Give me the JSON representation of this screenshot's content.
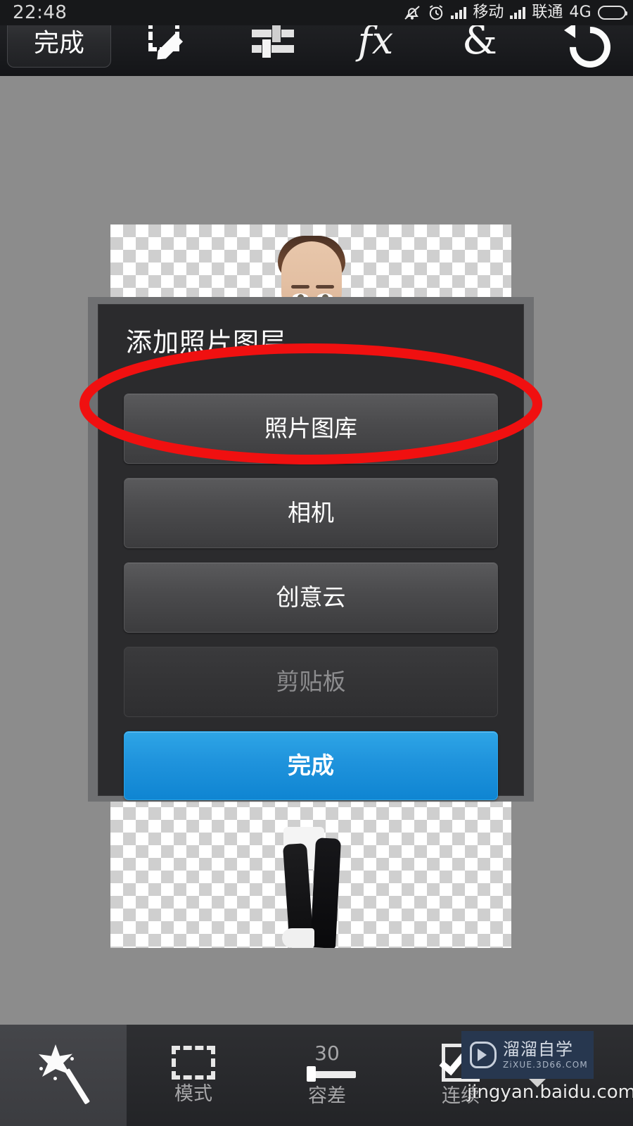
{
  "status_bar": {
    "clock": "22:48",
    "icons": [
      "bell-muted-icon",
      "alarm-clock-icon"
    ],
    "carrier_1": "移动",
    "carrier_2": "联通",
    "network_type": "4G",
    "battery_icon": "battery-icon"
  },
  "top_toolbar": {
    "done_label": "完成",
    "items": [
      {
        "name": "selection-edit-icon",
        "glyph": ""
      },
      {
        "name": "adjustments-sliders-icon",
        "glyph": ""
      },
      {
        "name": "effects-fx-icon",
        "glyph": "fx"
      },
      {
        "name": "blend-ampersand-icon",
        "glyph": "&"
      },
      {
        "name": "undo-icon",
        "glyph": ""
      }
    ]
  },
  "canvas": {
    "layer_kind": "transparent-checkerboard",
    "photo_description": "woman-cutout-photo-layer"
  },
  "dialog": {
    "title": "添加照片图层",
    "buttons": [
      {
        "id": "photo-library",
        "label": "照片图库",
        "style": "normal",
        "highlighted": true
      },
      {
        "id": "camera",
        "label": "相机",
        "style": "normal",
        "highlighted": false
      },
      {
        "id": "creative-cloud",
        "label": "创意云",
        "style": "normal",
        "highlighted": false
      },
      {
        "id": "clipboard",
        "label": "剪贴板",
        "style": "disabled",
        "highlighted": false
      },
      {
        "id": "done",
        "label": "完成",
        "style": "primary",
        "highlighted": false
      }
    ]
  },
  "annotation": {
    "shape": "ellipse",
    "color": "#f01010",
    "target": "照片图库"
  },
  "bottom_toolbar": {
    "tool_icon": "magic-wand-icon",
    "cells": [
      {
        "id": "mode",
        "icon": "dashed-marquee-icon",
        "value": "",
        "label": "模式"
      },
      {
        "id": "tolerance",
        "icon": "slider-icon",
        "value": "30",
        "label": "容差"
      },
      {
        "id": "contiguous",
        "icon": "checked-box-icon",
        "value": "",
        "label": "连续"
      }
    ]
  },
  "watermarks": {
    "badge_cn": "溜溜自学",
    "badge_en": "ZiXUE.3D66.COM",
    "badge_bg": "#27374f",
    "baidu": "jingyan.baidu.com"
  }
}
